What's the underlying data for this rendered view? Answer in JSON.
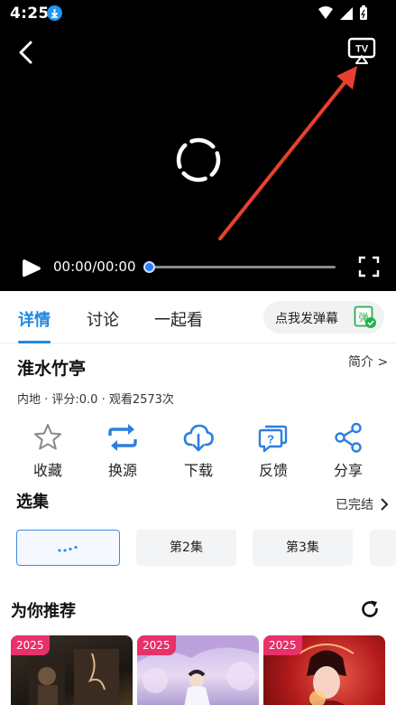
{
  "status_bar": {
    "time": "4:25"
  },
  "player": {
    "timecode": "00:00/00:00",
    "progress": 0
  },
  "tabs": [
    {
      "label": "详情",
      "active": true
    },
    {
      "label": "讨论",
      "active": false
    },
    {
      "label": "一起看",
      "active": false
    }
  ],
  "danmu": {
    "label": "点我发弹幕",
    "icon_char": "弹"
  },
  "info": {
    "title": "淮水竹亭",
    "intro_link": "简介 >",
    "meta": "内地 · 评分:0.0 · 观看2573次"
  },
  "actions": [
    {
      "label": "收藏",
      "icon": "star-icon"
    },
    {
      "label": "换源",
      "icon": "swap-icon"
    },
    {
      "label": "下载",
      "icon": "cloud-download-icon"
    },
    {
      "label": "反馈",
      "icon": "feedback-icon"
    },
    {
      "label": "分享",
      "icon": "share-icon"
    }
  ],
  "episodes": {
    "title": "选集",
    "status_link": "已完结",
    "items": [
      {
        "label": "",
        "current": true
      },
      {
        "label": "第2集",
        "current": false
      },
      {
        "label": "第3集",
        "current": false
      },
      {
        "label": "",
        "current": false
      }
    ]
  },
  "recommend": {
    "title": "为你推荐",
    "items": [
      {
        "year": "2025"
      },
      {
        "year": "2025"
      },
      {
        "year": "2025"
      }
    ]
  },
  "colors": {
    "accent": "#1e88e5",
    "year_badge": "#e8306a",
    "annotation_arrow": "#e8402f",
    "danmu_green": "#22b24c"
  }
}
